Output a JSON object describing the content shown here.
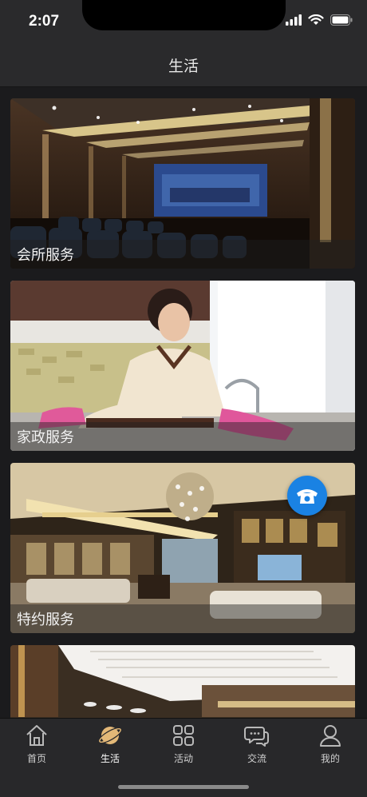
{
  "status": {
    "time": "2:07"
  },
  "nav": {
    "title": "生活"
  },
  "cards": [
    {
      "label": "会所服务"
    },
    {
      "label": "家政服务"
    },
    {
      "label": "特约服务"
    },
    {
      "label": ""
    }
  ],
  "tabs": [
    {
      "label": "首页",
      "icon": "home-icon"
    },
    {
      "label": "生活",
      "icon": "planet-icon"
    },
    {
      "label": "活动",
      "icon": "grid-icon"
    },
    {
      "label": "交流",
      "icon": "chat-icon"
    },
    {
      "label": "我的",
      "icon": "person-icon"
    }
  ],
  "active_tab": "生活",
  "colors": {
    "accent": "#e3b877",
    "fab": "#1a82e3",
    "bar": "#2a2a2c"
  }
}
